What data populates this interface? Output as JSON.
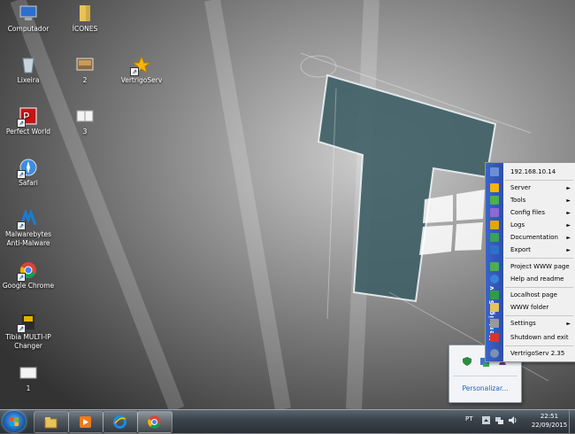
{
  "desktop": {
    "icons": [
      {
        "label": "Computador",
        "icon": "computer-icon"
      },
      {
        "label": "ÍCONES",
        "icon": "folder-icon"
      },
      {
        "label": "Lixeira",
        "icon": "recycle-bin-icon"
      },
      {
        "label": "2",
        "icon": "image-file-icon"
      },
      {
        "label": "VertrigoServ",
        "icon": "vertrigoserv-icon"
      },
      {
        "label": "Perfect World",
        "icon": "perfect-world-icon"
      },
      {
        "label": "3",
        "icon": "document-icon"
      },
      {
        "label": "Safari",
        "icon": "safari-icon"
      },
      {
        "label": "Malwarebytes Anti-Malware",
        "icon": "malwarebytes-icon"
      },
      {
        "label": "Google Chrome",
        "icon": "chrome-icon"
      },
      {
        "label": "Tibia MULTI-IP Changer",
        "icon": "tibia-icon"
      },
      {
        "label": "1",
        "icon": "file-icon"
      }
    ]
  },
  "tray_popup": {
    "customize_label": "Personalizar..."
  },
  "context_menu": {
    "sidebar_text": "VertrigoServ",
    "items": [
      {
        "label": "192.168.10.14",
        "icon": "network-icon",
        "submenu": false
      },
      {
        "label": "Server",
        "icon": "star-icon",
        "submenu": true
      },
      {
        "label": "Tools",
        "icon": "tools-icon",
        "submenu": true
      },
      {
        "label": "Config files",
        "icon": "config-icon",
        "submenu": true
      },
      {
        "label": "Logs",
        "icon": "logs-icon",
        "submenu": true
      },
      {
        "label": "Documentation",
        "icon": "documentation-icon",
        "submenu": true
      },
      {
        "label": "Export",
        "icon": "export-icon",
        "submenu": true
      },
      {
        "label": "Project WWW page",
        "icon": "home-icon",
        "submenu": false
      },
      {
        "label": "Help and readme",
        "icon": "help-icon",
        "submenu": false
      },
      {
        "label": "Localhost page",
        "icon": "localhost-icon",
        "submenu": false
      },
      {
        "label": "WWW folder",
        "icon": "folder-icon",
        "submenu": false
      },
      {
        "label": "Settings",
        "icon": "settings-icon",
        "submenu": true
      },
      {
        "label": "Shutdown and exit",
        "icon": "shutdown-icon",
        "submenu": false
      },
      {
        "label": "VertrigoServ 2.35",
        "icon": "info-icon",
        "submenu": false
      }
    ],
    "submenu_arrow": "►"
  },
  "taskbar": {
    "pinned": [
      {
        "name": "explorer",
        "icon": "file-explorer-icon"
      },
      {
        "name": "media-player",
        "icon": "media-player-icon"
      },
      {
        "name": "internet-explorer",
        "icon": "internet-explorer-icon"
      },
      {
        "name": "chrome",
        "icon": "chrome-icon"
      }
    ],
    "language": "PT",
    "time": "22:51",
    "date": "22/09/2015"
  }
}
